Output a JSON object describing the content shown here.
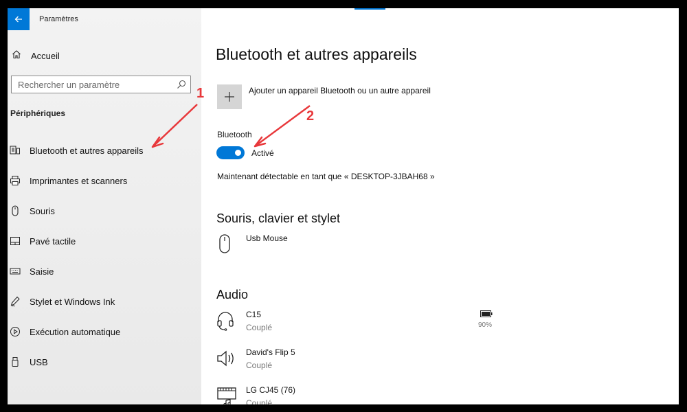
{
  "window": {
    "title": "Paramètres"
  },
  "sidebar": {
    "home_label": "Accueil",
    "search_placeholder": "Rechercher un paramètre",
    "section_title": "Périphériques",
    "items": [
      {
        "label": "Bluetooth et autres appareils",
        "icon": "bluetooth-devices-icon"
      },
      {
        "label": "Imprimantes et scanners",
        "icon": "printer-icon"
      },
      {
        "label": "Souris",
        "icon": "mouse-icon"
      },
      {
        "label": "Pavé tactile",
        "icon": "touchpad-icon"
      },
      {
        "label": "Saisie",
        "icon": "keyboard-icon"
      },
      {
        "label": "Stylet et Windows Ink",
        "icon": "pen-icon"
      },
      {
        "label": "Exécution automatique",
        "icon": "autoplay-icon"
      },
      {
        "label": "USB",
        "icon": "usb-icon"
      }
    ]
  },
  "main": {
    "title": "Bluetooth et autres appareils",
    "add_device_label": "Ajouter un appareil Bluetooth ou un autre appareil",
    "bluetooth": {
      "label": "Bluetooth",
      "state": "Activé",
      "on": true,
      "discoverable_text": "Maintenant détectable en tant que « DESKTOP-3JBAH68 »"
    },
    "sections": {
      "mouse_keyboard_pen": "Souris, clavier et stylet",
      "audio": "Audio"
    },
    "mouse_devices": [
      {
        "name": "Usb Mouse",
        "icon": "mouse-icon"
      }
    ],
    "audio_devices": [
      {
        "name": "C15",
        "status": "Couplé",
        "icon": "headset-icon",
        "battery": "90%"
      },
      {
        "name": "David's Flip 5",
        "status": "Couplé",
        "icon": "speaker-icon"
      },
      {
        "name": "LG CJ45  (76)",
        "status": "Couplé",
        "icon": "media-device-icon"
      }
    ]
  },
  "annotations": [
    {
      "label": "1",
      "color": "#e8383b"
    },
    {
      "label": "2",
      "color": "#e8383b"
    }
  ],
  "colors": {
    "accent": "#0078d7",
    "annotation": "#e8383b"
  }
}
